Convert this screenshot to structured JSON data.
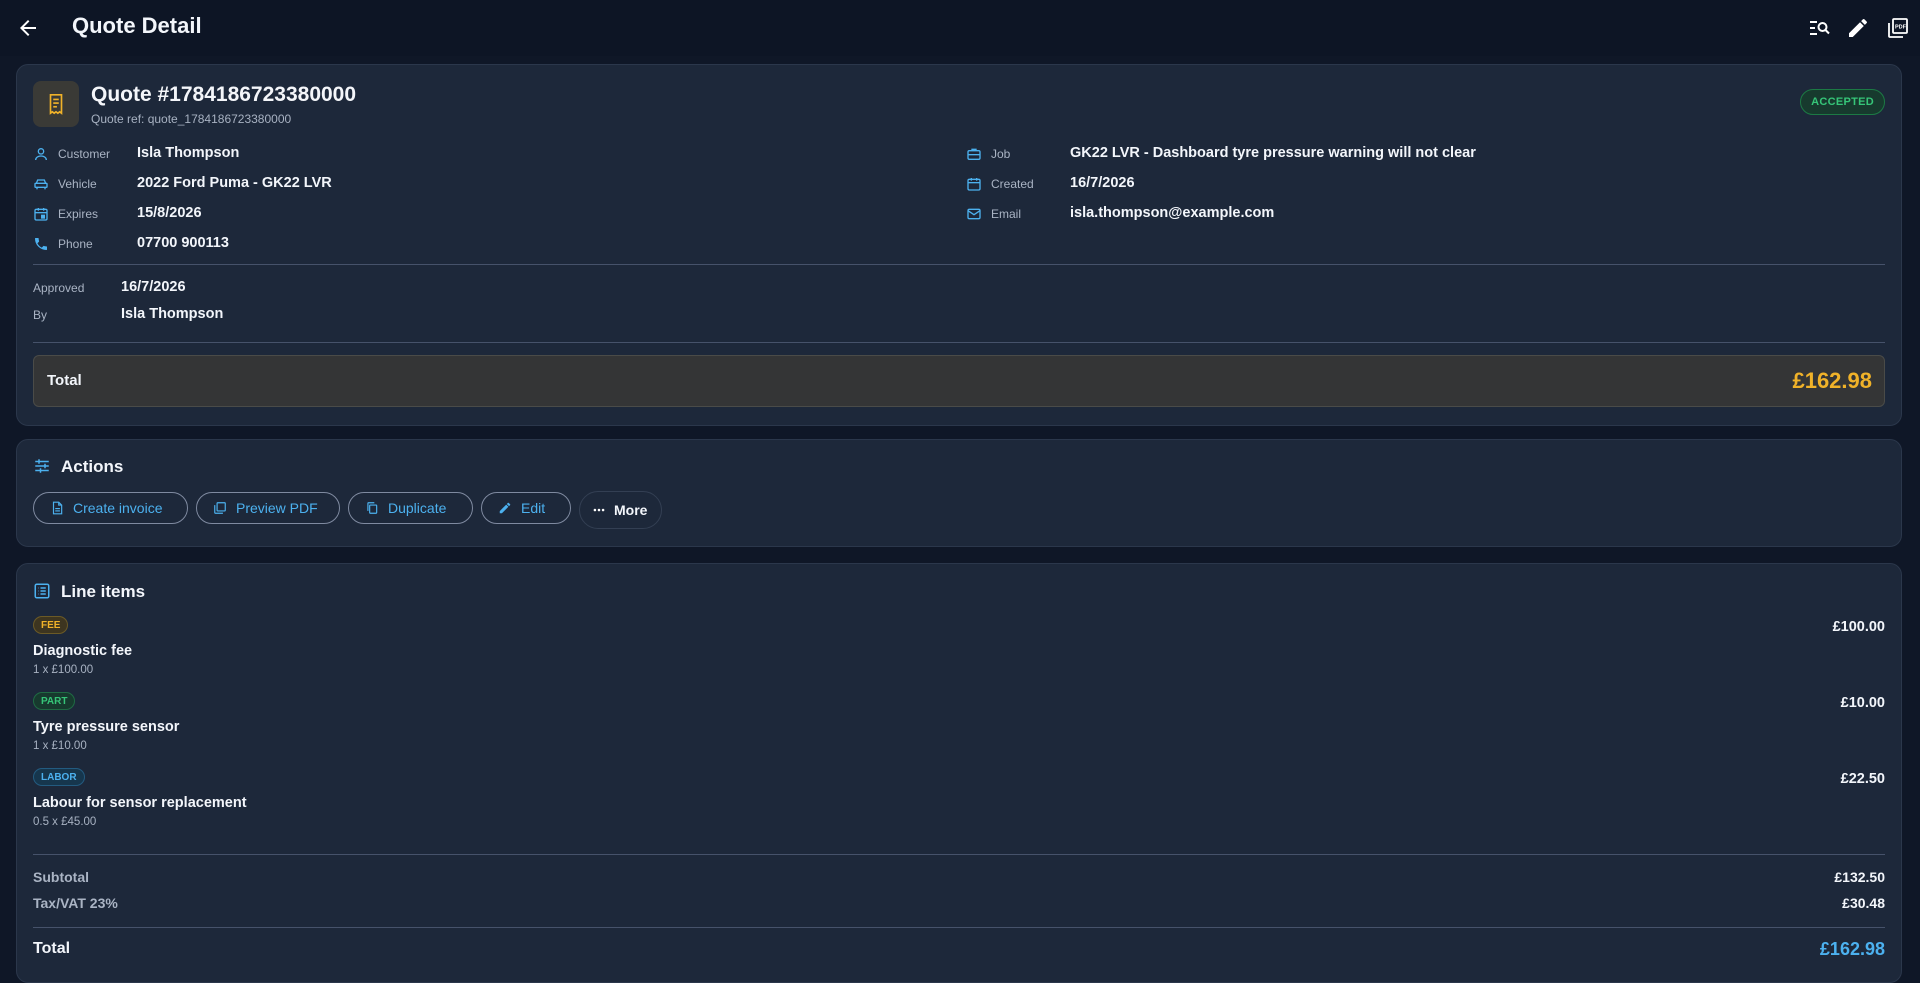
{
  "header": {
    "title": "Quote Detail"
  },
  "quote": {
    "title": "Quote #1784186723380000",
    "ref": "Quote ref: quote_1784186723380000",
    "status": "ACCEPTED",
    "fields_left": [
      {
        "icon": "person-icon",
        "label": "Customer",
        "value": "Isla Thompson"
      },
      {
        "icon": "car-icon",
        "label": "Vehicle",
        "value": "2022 Ford Puma - GK22 LVR"
      },
      {
        "icon": "calendar-event-icon",
        "label": "Expires",
        "value": "15/8/2026"
      },
      {
        "icon": "phone-icon",
        "label": "Phone",
        "value": "07700 900113"
      }
    ],
    "fields_right": [
      {
        "icon": "briefcase-icon",
        "label": "Job",
        "value": "GK22 LVR - Dashboard tyre pressure warning will not clear"
      },
      {
        "icon": "calendar-icon",
        "label": "Created",
        "value": "16/7/2026"
      },
      {
        "icon": "mail-icon",
        "label": "Email",
        "value": "isla.thompson@example.com"
      }
    ],
    "approval": {
      "approved_label": "Approved",
      "approved_value": "16/7/2026",
      "by_label": "By",
      "by_value": "Isla Thompson"
    },
    "total_label": "Total",
    "total_value": "£162.98"
  },
  "actions": {
    "title": "Actions",
    "buttons": [
      {
        "label": "Create invoice",
        "icon": "file-icon"
      },
      {
        "label": "Preview PDF",
        "icon": "pdf-icon"
      },
      {
        "label": "Duplicate",
        "icon": "copy-icon"
      },
      {
        "label": "Edit",
        "icon": "pencil-icon"
      }
    ],
    "more_label": "More"
  },
  "line_items": {
    "title": "Line items",
    "items": [
      {
        "type": "FEE",
        "name": "Diagnostic fee",
        "qty": "1 x £100.00",
        "amount": "£100.00"
      },
      {
        "type": "PART",
        "name": "Tyre pressure sensor",
        "qty": "1 x £10.00",
        "amount": "£10.00"
      },
      {
        "type": "LABOR",
        "name": "Labour for sensor replacement",
        "qty": "0.5 x £45.00",
        "amount": "£22.50"
      }
    ],
    "subtotal_label": "Subtotal",
    "subtotal_value": "£132.50",
    "tax_label": "Tax/VAT 23%",
    "tax_value": "£30.48",
    "total_label": "Total",
    "total_value": "£162.98"
  },
  "colors": {
    "accent": "#4cb1ef",
    "warning": "#f0b229",
    "success": "#36c578",
    "background": "#0f1727",
    "card": "#1d283a"
  }
}
